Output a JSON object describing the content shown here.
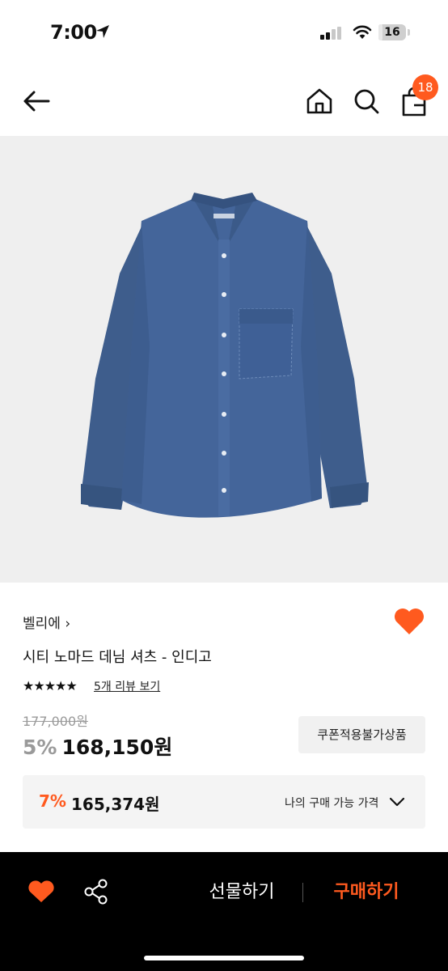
{
  "status_bar": {
    "time": "7:00",
    "battery": "16",
    "battery_level_percent": 16
  },
  "header": {
    "cart_count": "18"
  },
  "product": {
    "brand": "벨리에",
    "brand_chevron": "›",
    "title": "시티 노마드 데님 셔츠 - 인디고",
    "stars": "★★★★★",
    "rating": 5,
    "review_link": "5개 리뷰 보기",
    "original_price": "177,000원",
    "discount_rate": "5%",
    "sale_price": "168,150원",
    "coupon_badge": "쿠폰적용불가상품",
    "image": {
      "subject": "denim-shirt",
      "color": "#3f5f8f"
    }
  },
  "best_price": {
    "rate": "7%",
    "price": "165,374원",
    "label": "나의 구매 가능 가격"
  },
  "bottom_bar": {
    "gift_label": "선물하기",
    "buy_label": "구매하기"
  },
  "colors": {
    "accent": "#ff5a1f",
    "bottom_bar": "#000000",
    "image_bg": "#efefef"
  },
  "icons": [
    "location-arrow-icon",
    "signal-icon",
    "wifi-icon",
    "battery-icon",
    "back-arrow-icon",
    "home-icon",
    "search-icon",
    "shopping-bag-icon",
    "heart-icon",
    "share-icon",
    "chevron-down-icon"
  ]
}
